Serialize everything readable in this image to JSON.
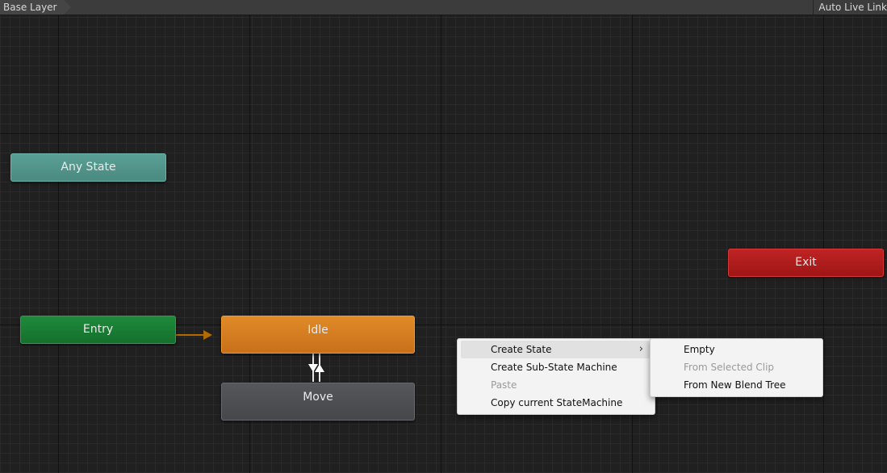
{
  "toolbar": {
    "breadcrumb": "Base Layer",
    "auto_live_link": "Auto Live Link"
  },
  "states": {
    "any_state": "Any State",
    "entry": "Entry",
    "idle": "Idle",
    "move": "Move",
    "exit": "Exit"
  },
  "colors": {
    "any_state": "#4a8a80",
    "entry": "#15702d",
    "idle": "#c8701a",
    "move": "#45474b",
    "exit": "#a01515",
    "default_transition": "#b36b00",
    "transition": "#e6e6e6"
  },
  "context_menu": {
    "items": [
      {
        "label": "Create State",
        "enabled": true,
        "has_submenu": true,
        "highlighted": true
      },
      {
        "label": "Create Sub-State Machine",
        "enabled": true
      },
      {
        "label": "Paste",
        "enabled": false
      },
      {
        "label": "Copy current StateMachine",
        "enabled": true
      }
    ],
    "submenu_arrow_icon": "chevron-right-icon",
    "submenu": [
      {
        "label": "Empty",
        "enabled": true
      },
      {
        "label": "From Selected Clip",
        "enabled": false
      },
      {
        "label": "From New Blend Tree",
        "enabled": true
      }
    ]
  }
}
